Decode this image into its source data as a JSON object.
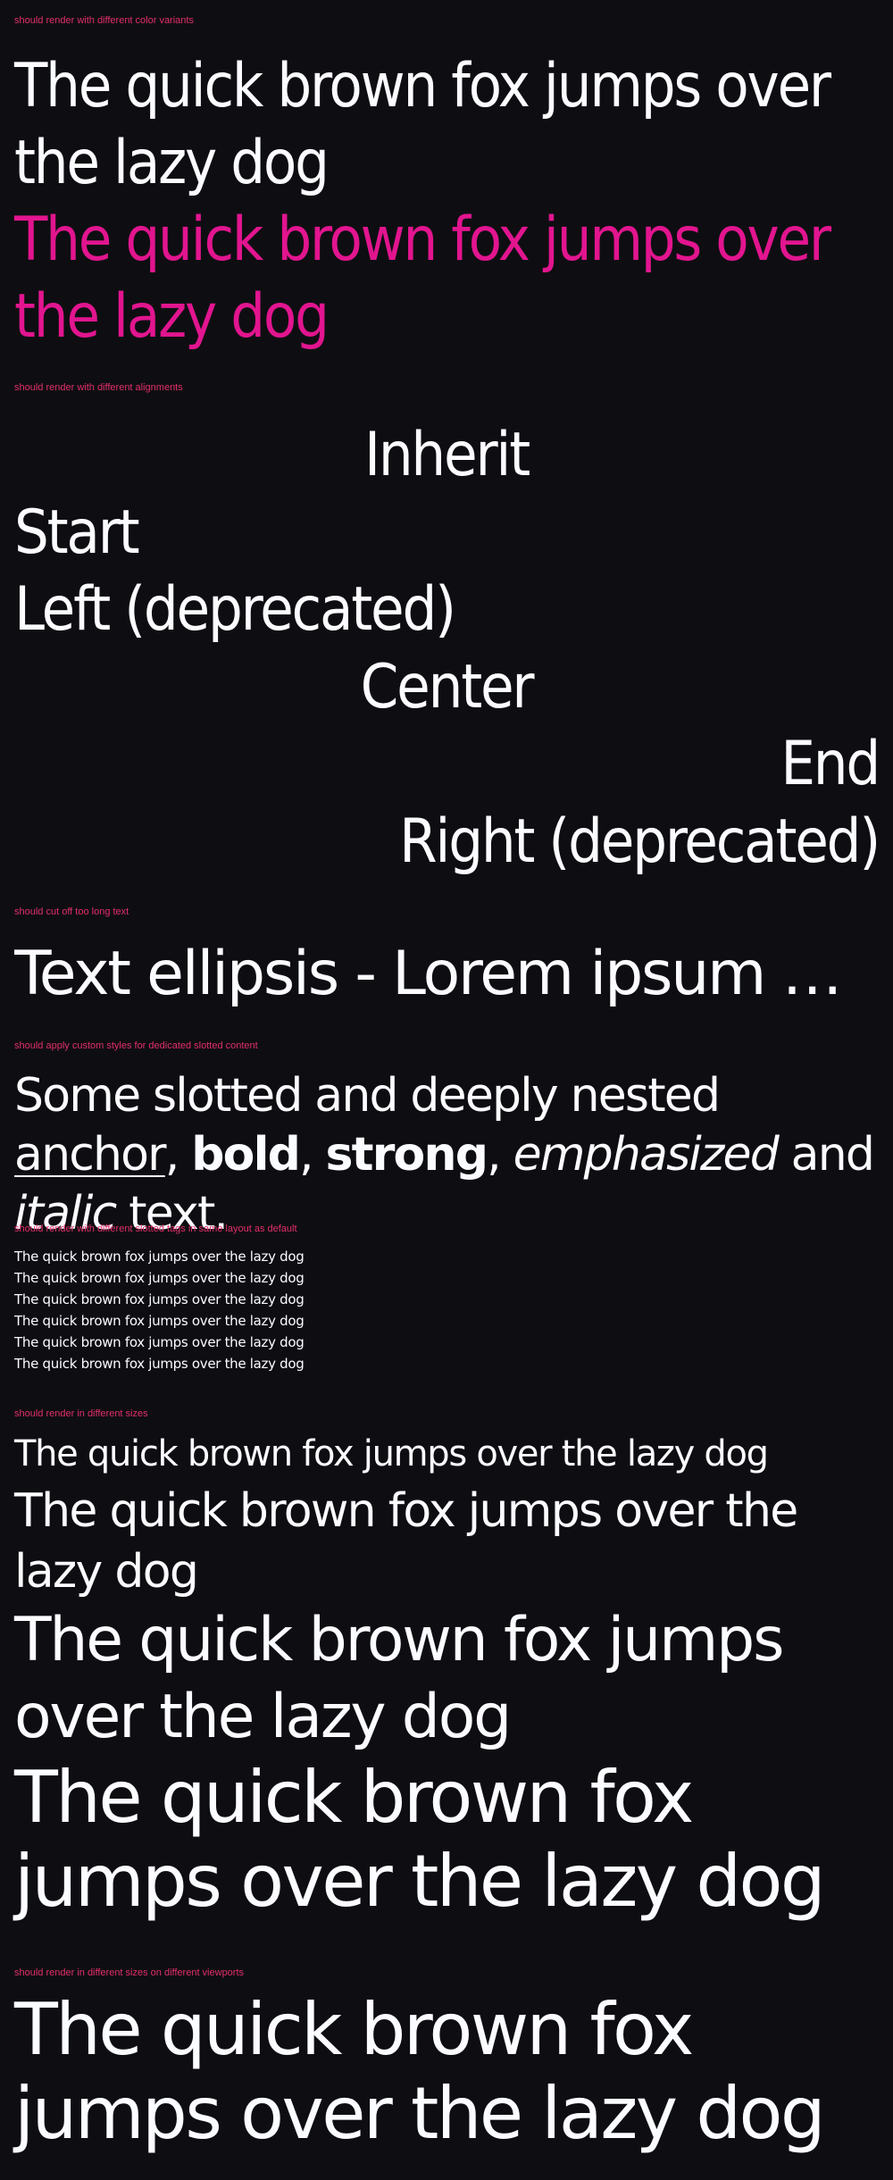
{
  "sections": {
    "colors": {
      "title": "should render with different color variants",
      "default_text": "The quick brown fox jumps over the lazy dog",
      "pink_text": "The quick brown fox jumps over the lazy dog",
      "accent_color": "#e2158f"
    },
    "alignments": {
      "title": "should render with different alignments",
      "inherit": "Inherit",
      "start": "Start",
      "left": "Left (deprecated)",
      "center": "Center",
      "end": "End",
      "right": "Right (deprecated)"
    },
    "ellipsis": {
      "title": "should cut off too long text",
      "text": "Text ellipsis - Lorem ipsum dolor sit amet, consetetur sadipscing elitr, sed diam nonumy eirmod tempor invidunt ut labore et dolore magna aliquyam erat"
    },
    "slotted": {
      "title": "should apply custom styles for dedicated slotted content",
      "intro": "Some slotted and deeply nested ",
      "anchor": "anchor",
      "sep1": ",",
      "bold": "bold",
      "sep2": ", ",
      "strong": "strong",
      "sep3": ", ",
      "emphasized": "emphasized",
      "and": " and ",
      "italic": "italic",
      "outro": " text."
    },
    "tags": {
      "title": "should render with different slotted tags in same layout as default",
      "lines": [
        "The quick brown fox jumps over the lazy dog",
        "The quick brown fox jumps over the lazy dog",
        "The quick brown fox jumps over the lazy dog",
        "The quick brown fox jumps over the lazy dog",
        "The quick brown fox jumps over the lazy dog",
        "The quick brown fox jumps over the lazy dog"
      ]
    },
    "sizes": {
      "title": "should render in different sizes",
      "small": "The quick brown fox jumps over the lazy dog",
      "medium": "The quick brown fox jumps over the lazy dog",
      "large": "The quick brown fox jumps over the lazy dog",
      "xlarge": "The quick brown fox jumps over the lazy dog"
    },
    "viewports": {
      "title": "should render in different sizes on different viewports",
      "text": "The quick brown fox jumps over the lazy dog"
    }
  }
}
